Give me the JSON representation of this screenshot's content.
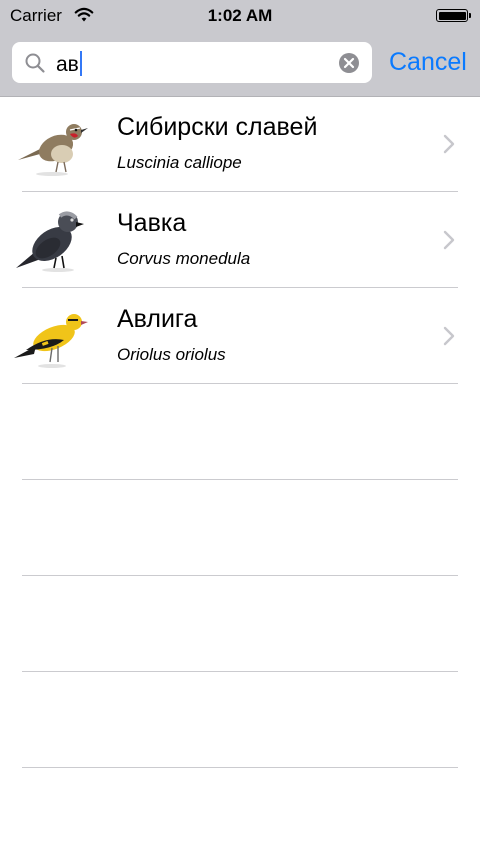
{
  "status_bar": {
    "carrier": "Carrier",
    "time": "1:02 AM",
    "battery_level": 1.0
  },
  "search": {
    "value": "ав",
    "cancel_label": "Cancel",
    "icons": [
      "search-icon",
      "clear-icon"
    ]
  },
  "results": [
    {
      "name": "Сибирски славей",
      "scientific": "Luscinia calliope",
      "image": "siberian-rubythroat-bird"
    },
    {
      "name": "Чавка",
      "scientific": "Corvus monedula",
      "image": "jackdaw-bird"
    },
    {
      "name": "Авлига",
      "scientific": "Oriolus oriolus",
      "image": "golden-oriole-bird"
    }
  ],
  "colors": {
    "accent": "#0a7aff",
    "header_bg": "#c9c9ce",
    "separator": "#cbcbcf",
    "caret": "#3478f6"
  }
}
